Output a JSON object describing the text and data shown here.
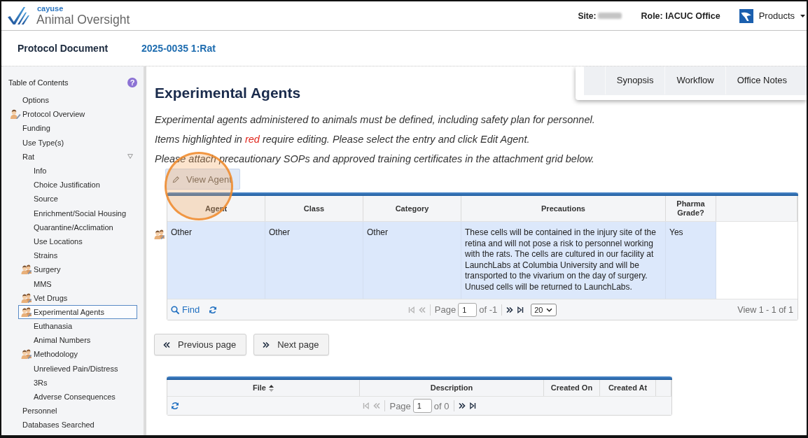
{
  "header": {
    "brand": "cayuse",
    "product": "Animal Oversight",
    "site": {
      "label": "Site:",
      "redacted": true
    },
    "role": "Role: IACUC Office",
    "products_menu": "Products"
  },
  "document": {
    "label": "Protocol Document",
    "number": "2025-0035 1:Rat"
  },
  "toc": {
    "title": "Table of Contents",
    "help": "?",
    "items": [
      {
        "label": "Options",
        "kind": "plain",
        "selected": false
      },
      {
        "label": "Protocol Overview",
        "kind": "person",
        "selected": false
      },
      {
        "label": "Funding",
        "kind": "plain",
        "selected": false
      },
      {
        "label": "Use Type(s)",
        "kind": "plain",
        "selected": false
      },
      {
        "label": "Rat",
        "kind": "plain",
        "selected": false,
        "expanded": true,
        "children": [
          {
            "label": "Info",
            "kind": "plain",
            "selected": false
          },
          {
            "label": "Choice Justification",
            "kind": "plain",
            "selected": false
          },
          {
            "label": "Source",
            "kind": "plain",
            "selected": false
          },
          {
            "label": "Enrichment/Social Housing",
            "kind": "plain",
            "selected": false
          },
          {
            "label": "Quarantine/Acclimation",
            "kind": "plain",
            "selected": false
          },
          {
            "label": "Use Locations",
            "kind": "plain",
            "selected": false
          },
          {
            "label": "Strains",
            "kind": "plain",
            "selected": false
          },
          {
            "label": "Surgery",
            "kind": "group",
            "selected": false
          },
          {
            "label": "MMS",
            "kind": "plain",
            "selected": false
          },
          {
            "label": "Vet Drugs",
            "kind": "group",
            "selected": false
          },
          {
            "label": "Experimental Agents",
            "kind": "group",
            "selected": true
          },
          {
            "label": "Euthanasia",
            "kind": "plain",
            "selected": false
          },
          {
            "label": "Animal Numbers",
            "kind": "plain",
            "selected": false
          },
          {
            "label": "Methodology",
            "kind": "group",
            "selected": false
          },
          {
            "label": "Unrelieved Pain/Distress",
            "kind": "plain",
            "selected": false
          },
          {
            "label": "3Rs",
            "kind": "plain",
            "selected": false
          },
          {
            "label": "Adverse Consequences",
            "kind": "plain",
            "selected": false
          }
        ]
      },
      {
        "label": "Personnel",
        "kind": "plain",
        "selected": false
      },
      {
        "label": "Databases Searched",
        "kind": "plain",
        "selected": false
      }
    ]
  },
  "page": {
    "title": "Experimental Agents",
    "tabs": [
      {
        "label": "Synopsis",
        "selected": false
      },
      {
        "label": "Workflow",
        "selected": false
      },
      {
        "label": "Office Notes",
        "selected": false
      }
    ],
    "instructions": [
      [
        {
          "text": "Experimental agents administered to animals must be defined, including safety plan for personnel.",
          "highlight": false
        }
      ],
      [
        {
          "text": "Items highlighted in ",
          "highlight": false
        },
        {
          "text": "red",
          "highlight": true
        },
        {
          "text": " require editing. Please select the entry and click Edit Agent.",
          "highlight": false
        }
      ],
      [
        {
          "text": "Please attach precautionary SOPs and approved training certificates in the attachment grid below.",
          "highlight": false
        }
      ]
    ],
    "view_agent": {
      "label": "View Agent",
      "highlighted": true
    },
    "agents_grid": {
      "columns": [
        "Agent",
        "Class",
        "Category",
        "Precautions",
        "Pharma Grade?"
      ],
      "rows": [
        {
          "kind": "group",
          "selected": true,
          "cells": [
            "Other",
            "Other",
            "Other",
            "These cells will be contained in the injury site of the retina and will not pose a risk to personnel working with the rats. The cells are cultured in our facility at LaunchLabs at Columbia University and will be transported to the vivarium on the day of surgery. Unused cells will be returned to LaunchLabs.",
            "Yes"
          ]
        }
      ],
      "footer": {
        "find": "Find",
        "page_label": "Page",
        "page": "1",
        "page_count": "of -1",
        "page_size": "20",
        "summary": "View 1 - 1 of 1",
        "back_disabled": true,
        "forward_disabled": false
      }
    },
    "nav_buttons": [
      {
        "label": "Previous page",
        "kind": "previous"
      },
      {
        "label": "Next page",
        "kind": "next"
      }
    ],
    "attachments_grid": {
      "columns": [
        {
          "label": "File",
          "sortable": true
        },
        {
          "label": "Description",
          "sortable": false
        },
        {
          "label": "Created On",
          "sortable": false
        },
        {
          "label": "Created At",
          "sortable": false
        }
      ],
      "footer": {
        "page_label": "Page",
        "page": "1",
        "page_count": "of 0",
        "back_disabled": true,
        "forward_disabled": false
      }
    }
  }
}
